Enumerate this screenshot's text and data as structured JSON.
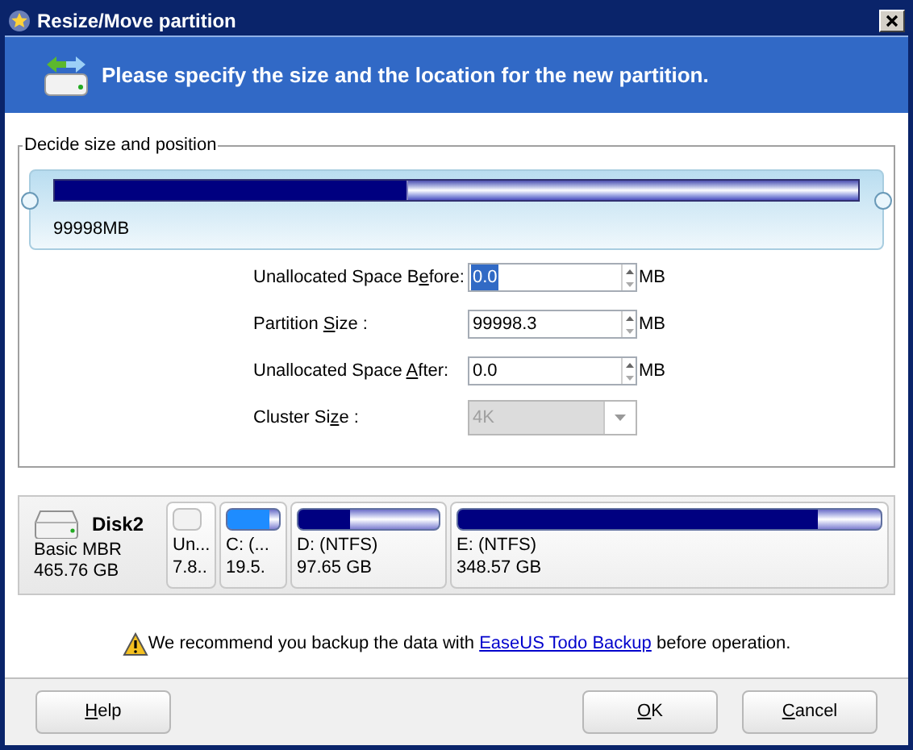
{
  "window": {
    "title": "Resize/Move partition"
  },
  "header": {
    "text": "Please specify the size and the location for the new partition."
  },
  "group": {
    "title": "Decide size and position",
    "slider": {
      "level": 0.44,
      "reading": "99998MB"
    },
    "fields": [
      {
        "kind": "spin",
        "label": {
          "before": "Unallocated Space B",
          "key": "e",
          "after": "fore:"
        },
        "value": "0.0",
        "unit": "MB",
        "selected": true
      },
      {
        "kind": "spin",
        "label": {
          "before": "Partition ",
          "key": "S",
          "after": "ize :"
        },
        "value": "99998.3",
        "unit": "MB",
        "selected": false
      },
      {
        "kind": "spin",
        "label": {
          "before": "Unallocated Space ",
          "key": "A",
          "after": "fter:"
        },
        "value": "0.0",
        "unit": "MB",
        "selected": false
      },
      {
        "kind": "select",
        "label": {
          "before": "Cluster Si",
          "key": "z",
          "after": "e :"
        },
        "value": "4K",
        "disabled": true
      }
    ]
  },
  "disk": {
    "name": "Disk2",
    "type": "Basic MBR",
    "size": "465.76 GB",
    "partitions": [
      {
        "kind": "unallocated",
        "label": "Un...",
        "size": "7.8.."
      },
      {
        "kind": "partition",
        "label": "C: (...",
        "size": "19.5.",
        "level": 0.8,
        "color": "#1e8cff"
      },
      {
        "kind": "partition",
        "label": "D: (NTFS)",
        "size": "97.65 GB",
        "level": 0.37,
        "color": "#000080"
      },
      {
        "kind": "partition",
        "label": "E: (NTFS)",
        "size": "348.57 GB",
        "level": 0.85,
        "color": "#000080"
      }
    ]
  },
  "notice": {
    "before": "We recommend you backup the data with ",
    "link": "EaseUS Todo Backup",
    "after": " before operation."
  },
  "buttons": [
    {
      "label": {
        "key": "H",
        "after": "elp"
      }
    },
    {
      "label": {
        "key": "O",
        "after": "K"
      }
    },
    {
      "label": {
        "key": "C",
        "after": "ancel"
      }
    }
  ]
}
